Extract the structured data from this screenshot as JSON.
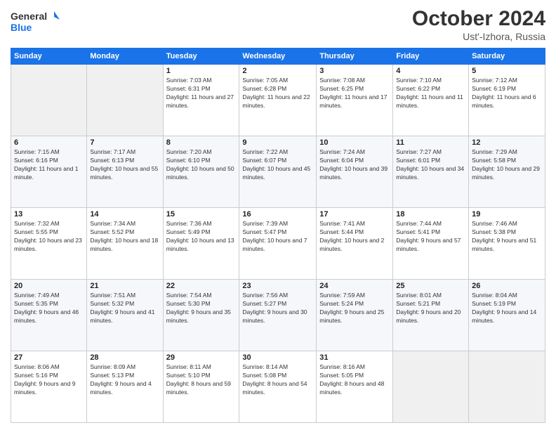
{
  "header": {
    "logo_line1": "General",
    "logo_line2": "Blue",
    "month_title": "October 2024",
    "location": "Ust'-Izhora, Russia"
  },
  "weekdays": [
    "Sunday",
    "Monday",
    "Tuesday",
    "Wednesday",
    "Thursday",
    "Friday",
    "Saturday"
  ],
  "weeks": [
    [
      {
        "day": "",
        "info": ""
      },
      {
        "day": "",
        "info": ""
      },
      {
        "day": "1",
        "info": "Sunrise: 7:03 AM\nSunset: 6:31 PM\nDaylight: 11 hours and 27 minutes."
      },
      {
        "day": "2",
        "info": "Sunrise: 7:05 AM\nSunset: 6:28 PM\nDaylight: 11 hours and 22 minutes."
      },
      {
        "day": "3",
        "info": "Sunrise: 7:08 AM\nSunset: 6:25 PM\nDaylight: 11 hours and 17 minutes."
      },
      {
        "day": "4",
        "info": "Sunrise: 7:10 AM\nSunset: 6:22 PM\nDaylight: 11 hours and 11 minutes."
      },
      {
        "day": "5",
        "info": "Sunrise: 7:12 AM\nSunset: 6:19 PM\nDaylight: 11 hours and 6 minutes."
      }
    ],
    [
      {
        "day": "6",
        "info": "Sunrise: 7:15 AM\nSunset: 6:16 PM\nDaylight: 11 hours and 1 minute."
      },
      {
        "day": "7",
        "info": "Sunrise: 7:17 AM\nSunset: 6:13 PM\nDaylight: 10 hours and 55 minutes."
      },
      {
        "day": "8",
        "info": "Sunrise: 7:20 AM\nSunset: 6:10 PM\nDaylight: 10 hours and 50 minutes."
      },
      {
        "day": "9",
        "info": "Sunrise: 7:22 AM\nSunset: 6:07 PM\nDaylight: 10 hours and 45 minutes."
      },
      {
        "day": "10",
        "info": "Sunrise: 7:24 AM\nSunset: 6:04 PM\nDaylight: 10 hours and 39 minutes."
      },
      {
        "day": "11",
        "info": "Sunrise: 7:27 AM\nSunset: 6:01 PM\nDaylight: 10 hours and 34 minutes."
      },
      {
        "day": "12",
        "info": "Sunrise: 7:29 AM\nSunset: 5:58 PM\nDaylight: 10 hours and 29 minutes."
      }
    ],
    [
      {
        "day": "13",
        "info": "Sunrise: 7:32 AM\nSunset: 5:55 PM\nDaylight: 10 hours and 23 minutes."
      },
      {
        "day": "14",
        "info": "Sunrise: 7:34 AM\nSunset: 5:52 PM\nDaylight: 10 hours and 18 minutes."
      },
      {
        "day": "15",
        "info": "Sunrise: 7:36 AM\nSunset: 5:49 PM\nDaylight: 10 hours and 13 minutes."
      },
      {
        "day": "16",
        "info": "Sunrise: 7:39 AM\nSunset: 5:47 PM\nDaylight: 10 hours and 7 minutes."
      },
      {
        "day": "17",
        "info": "Sunrise: 7:41 AM\nSunset: 5:44 PM\nDaylight: 10 hours and 2 minutes."
      },
      {
        "day": "18",
        "info": "Sunrise: 7:44 AM\nSunset: 5:41 PM\nDaylight: 9 hours and 57 minutes."
      },
      {
        "day": "19",
        "info": "Sunrise: 7:46 AM\nSunset: 5:38 PM\nDaylight: 9 hours and 51 minutes."
      }
    ],
    [
      {
        "day": "20",
        "info": "Sunrise: 7:49 AM\nSunset: 5:35 PM\nDaylight: 9 hours and 46 minutes."
      },
      {
        "day": "21",
        "info": "Sunrise: 7:51 AM\nSunset: 5:32 PM\nDaylight: 9 hours and 41 minutes."
      },
      {
        "day": "22",
        "info": "Sunrise: 7:54 AM\nSunset: 5:30 PM\nDaylight: 9 hours and 35 minutes."
      },
      {
        "day": "23",
        "info": "Sunrise: 7:56 AM\nSunset: 5:27 PM\nDaylight: 9 hours and 30 minutes."
      },
      {
        "day": "24",
        "info": "Sunrise: 7:59 AM\nSunset: 5:24 PM\nDaylight: 9 hours and 25 minutes."
      },
      {
        "day": "25",
        "info": "Sunrise: 8:01 AM\nSunset: 5:21 PM\nDaylight: 9 hours and 20 minutes."
      },
      {
        "day": "26",
        "info": "Sunrise: 8:04 AM\nSunset: 5:19 PM\nDaylight: 9 hours and 14 minutes."
      }
    ],
    [
      {
        "day": "27",
        "info": "Sunrise: 8:06 AM\nSunset: 5:16 PM\nDaylight: 9 hours and 9 minutes."
      },
      {
        "day": "28",
        "info": "Sunrise: 8:09 AM\nSunset: 5:13 PM\nDaylight: 9 hours and 4 minutes."
      },
      {
        "day": "29",
        "info": "Sunrise: 8:11 AM\nSunset: 5:10 PM\nDaylight: 8 hours and 59 minutes."
      },
      {
        "day": "30",
        "info": "Sunrise: 8:14 AM\nSunset: 5:08 PM\nDaylight: 8 hours and 54 minutes."
      },
      {
        "day": "31",
        "info": "Sunrise: 8:16 AM\nSunset: 5:05 PM\nDaylight: 8 hours and 48 minutes."
      },
      {
        "day": "",
        "info": ""
      },
      {
        "day": "",
        "info": ""
      }
    ]
  ]
}
